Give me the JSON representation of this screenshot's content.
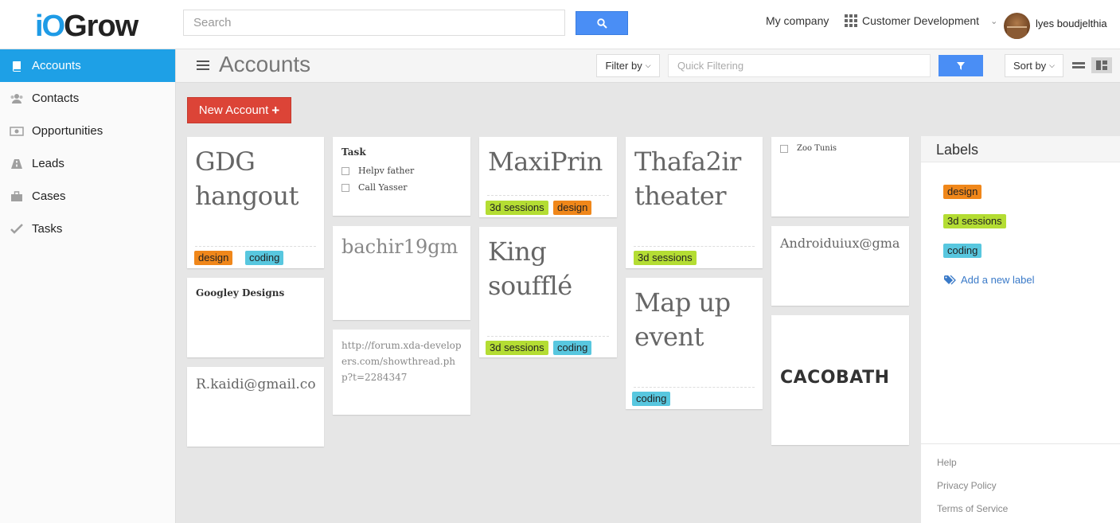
{
  "header": {
    "logo_io": "iO",
    "logo_grow": "Grow",
    "search_placeholder": "Search",
    "company": "My company",
    "workspace": "Customer Development",
    "user_name": "lyes boudjelthia"
  },
  "sidebar": {
    "items": [
      {
        "label": "Accounts",
        "icon": "book-icon",
        "active": true
      },
      {
        "label": "Contacts",
        "icon": "users-icon",
        "active": false
      },
      {
        "label": "Opportunities",
        "icon": "money-icon",
        "active": false
      },
      {
        "label": "Leads",
        "icon": "road-icon",
        "active": false
      },
      {
        "label": "Cases",
        "icon": "briefcase-icon",
        "active": false
      },
      {
        "label": "Tasks",
        "icon": "check-icon",
        "active": false
      }
    ]
  },
  "toolbar": {
    "title": "Accounts",
    "filter_label": "Filter by",
    "quick_filter_placeholder": "Quick Filtering",
    "sort_label": "Sort by",
    "new_account_label": "New Account"
  },
  "cards": {
    "gdg": {
      "line1": "GDG",
      "line2": "hangout",
      "tags": [
        "design",
        "coding"
      ]
    },
    "googley": {
      "title": "Googley Designs"
    },
    "rkaidi": {
      "title": "R.kaidi@gmail.co"
    },
    "task": {
      "title": "Task",
      "items": [
        "Helpv father",
        "Call Yasser"
      ]
    },
    "bachir": {
      "title": "bachir19gm"
    },
    "forum": {
      "text": "http://forum.xda-developers.com/showthread.php?t=2284347"
    },
    "maxiprin": {
      "title": "MaxiPrin",
      "tags": [
        "3d sessions",
        "design"
      ]
    },
    "king": {
      "line1": "King",
      "line2": "soufflé",
      "tags": [
        "3d sessions",
        "coding"
      ]
    },
    "thafa": {
      "line1": "Thafa2ir",
      "line2": "theater",
      "tags": [
        "3d sessions"
      ]
    },
    "mapup": {
      "line1": "Map up",
      "line2": "event",
      "tags": [
        "coding"
      ]
    },
    "zoo": {
      "item": "Zoo Tunis"
    },
    "android": {
      "title": "Androiduiux@gma"
    },
    "cacobath": {
      "logo_text": "CACOBATH"
    }
  },
  "labels_panel": {
    "title": "Labels",
    "labels": [
      "design",
      "3d sessions",
      "coding"
    ],
    "add_label": "Add a new label",
    "footer": [
      "Help",
      "Privacy Policy",
      "Terms of Service"
    ]
  },
  "colors": {
    "accent_blue": "#1ea0e6",
    "button_blue": "#4a8ef5",
    "new_account_red": "#dc4437",
    "tag_design": "#f0871a",
    "tag_3d_sessions": "#b4dd33",
    "tag_coding": "#58c7df"
  }
}
